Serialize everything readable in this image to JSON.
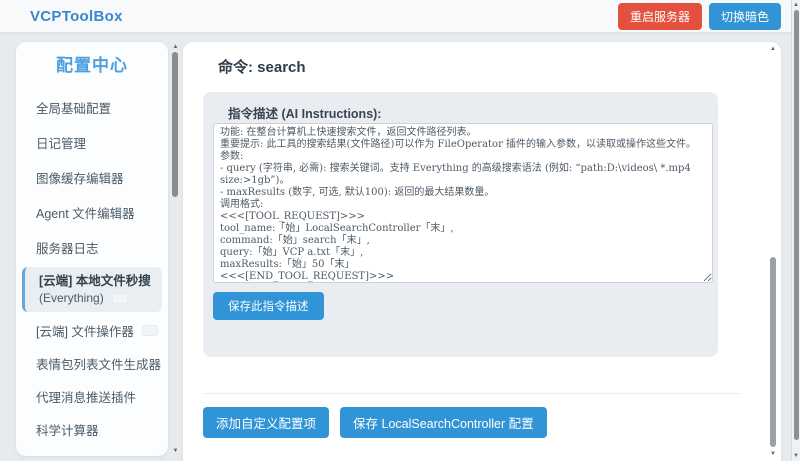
{
  "header": {
    "title": "VCPToolBox",
    "restart_button": "重启服务器",
    "theme_button": "切换暗色"
  },
  "sidebar": {
    "title": "配置中心",
    "items": [
      {
        "label": "全局基础配置"
      },
      {
        "label": "日记管理"
      },
      {
        "label": "图像缓存编辑器"
      },
      {
        "label": "Agent 文件编辑器"
      },
      {
        "label": "服务器日志"
      },
      {
        "label": "[云端] 本地文件秒搜",
        "sublabel": "(Everything)",
        "selected": true
      },
      {
        "label": "[云端] 文件操作器"
      },
      {
        "label": "表情包列表文件生成器"
      },
      {
        "label": "代理消息推送插件"
      },
      {
        "label": "科学计算器"
      }
    ]
  },
  "main": {
    "command_title": "命令: search",
    "instructions_label": "指令描述 (AI Instructions):",
    "instructions_text": "功能: 在整台计算机上快速搜索文件，返回文件路径列表。\n重要提示: 此工具的搜索结果(文件路径)可以作为 FileOperator 插件的输入参数，以读取或操作这些文件。\n参数:\n- query (字符串, 必需): 搜索关键词。支持 Everything 的高级搜索语法 (例如: “path:D:\\videos\\ *.mp4 size:>1gb”)。\n- maxResults (数字, 可选, 默认100): 返回的最大结果数量。\n调用格式:\n<<<[TOOL_REQUEST]>>>\ntool_name:「始」LocalSearchController「末」,\ncommand:「始」search「末」,\nquery:「始」VCP a.txt「末」,\nmaxResults:「始」50「末」\n<<<[END_TOOL_REQUEST]>>>",
    "save_instruction_button": "保存此指令描述",
    "add_config_button": "添加自定义配置项",
    "save_config_button": "保存 LocalSearchController 配置"
  },
  "scrollbars": {
    "up_glyph": "▲",
    "down_glyph": "▼"
  },
  "colors": {
    "brand": "#3b87cf",
    "accent": "#3194d6",
    "danger": "#e3503e",
    "sidebar-title": "#4e9fe0",
    "selected-item-bg": "#e9eef3",
    "selected-item-border": "#6aa7d8"
  }
}
